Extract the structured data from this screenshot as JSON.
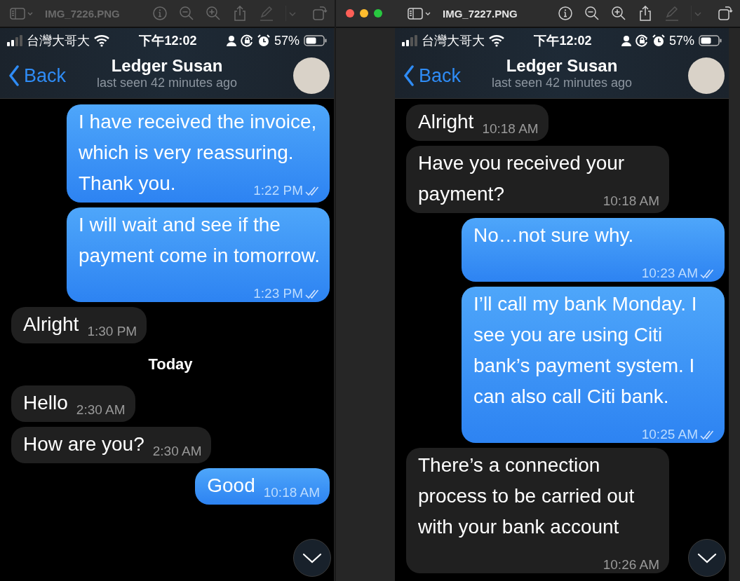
{
  "windows": [
    {
      "file_name": "IMG_7226.PNG",
      "active": false,
      "phone": {
        "carrier": "台灣大哥大",
        "time": "下午12:02",
        "battery": "57%",
        "back": "Back",
        "contact": "Ledger Susan",
        "last_seen": "last seen 42 minutes ago",
        "messages": [
          {
            "kind": "outgoing",
            "text": "I have received the invoice, which is very reassuring. Thank you.",
            "time": "1:22 PM",
            "read": true
          },
          {
            "kind": "outgoing",
            "text": "I will wait and see if the payment come in tomorrow.",
            "time": "1:23 PM",
            "read": true
          },
          {
            "kind": "incoming",
            "text": "Alright",
            "time": "1:30 PM"
          },
          {
            "kind": "date",
            "text": "Today"
          },
          {
            "kind": "incoming",
            "text": "Hello",
            "time": "2:30 AM"
          },
          {
            "kind": "incoming",
            "text": "How are you?",
            "time": "2:30 AM"
          },
          {
            "kind": "outgoing",
            "text": "Good",
            "time": "10:18 AM",
            "read": false
          }
        ]
      }
    },
    {
      "file_name": "IMG_7227.PNG",
      "active": true,
      "phone": {
        "carrier": "台灣大哥大",
        "time": "下午12:02",
        "battery": "57%",
        "back": "Back",
        "contact": "Ledger Susan",
        "last_seen": "last seen 42 minutes ago",
        "messages": [
          {
            "kind": "incoming",
            "text": "Alright",
            "time": "10:18 AM"
          },
          {
            "kind": "incoming",
            "text": "Have you received your payment?",
            "time": "10:18 AM"
          },
          {
            "kind": "outgoing",
            "text": "No…not sure why.",
            "time": "10:23 AM",
            "read": true
          },
          {
            "kind": "outgoing",
            "text": "I’ll call my bank Monday. I see you are using Citi bank’s payment system. I can also call Citi bank.",
            "time": "10:25 AM",
            "read": true
          },
          {
            "kind": "incoming",
            "text": "There’s a connection process to be carried out with your bank account",
            "time": "10:26 AM"
          }
        ]
      }
    }
  ]
}
